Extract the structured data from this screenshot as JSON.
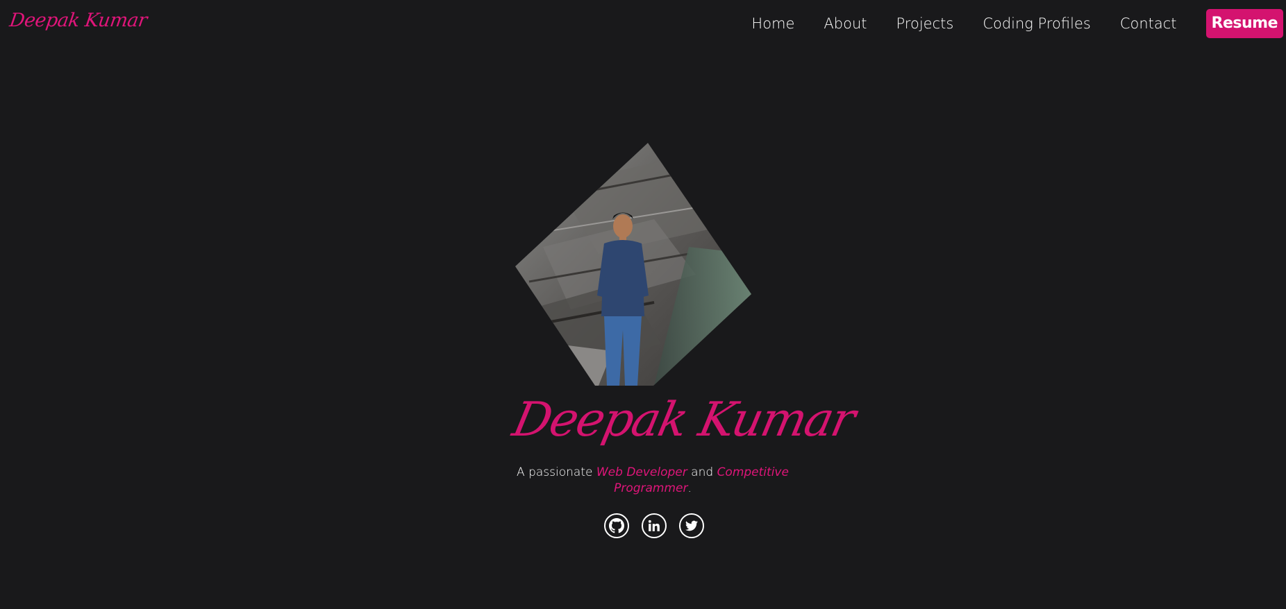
{
  "brand": {
    "logo_text": "Deepak Kumar"
  },
  "nav": {
    "items": [
      {
        "label": "Home"
      },
      {
        "label": "About"
      },
      {
        "label": "Projects"
      },
      {
        "label": "Coding Profiles"
      },
      {
        "label": "Contact"
      }
    ],
    "resume_label": "Resume"
  },
  "hero": {
    "name": "Deepak Kumar",
    "tagline": {
      "prefix": "A passionate ",
      "role1": "Web Developer",
      "middle": " and ",
      "role2": "Competitive Programmer",
      "suffix": "."
    },
    "socials": [
      {
        "icon": "github-icon"
      },
      {
        "icon": "linkedin-icon"
      },
      {
        "icon": "twitter-icon"
      }
    ]
  },
  "colors": {
    "background": "#19191b",
    "accent": "#d4136f",
    "text": "#ffffff"
  }
}
